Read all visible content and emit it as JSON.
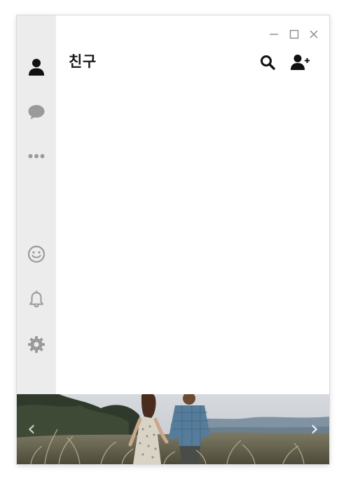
{
  "header": {
    "title": "친구"
  },
  "sidebar": {
    "items": [
      {
        "icon": "person-icon",
        "active": true
      },
      {
        "icon": "chat-bubble-icon",
        "active": false
      },
      {
        "icon": "more-dots-icon",
        "active": false
      },
      {
        "icon": "smiley-icon",
        "active": false
      },
      {
        "icon": "bell-icon",
        "active": false
      },
      {
        "icon": "gear-icon",
        "active": false
      }
    ]
  },
  "window_controls": [
    "minimize-icon",
    "maximize-icon",
    "close-icon"
  ],
  "header_actions": [
    "search-icon",
    "add-friend-icon"
  ],
  "banner": {
    "prev": "‹",
    "next": "›"
  },
  "colors": {
    "sidebar_bg": "#ececec",
    "active_icon": "#111111",
    "inactive_icon": "#9a9a9a"
  }
}
